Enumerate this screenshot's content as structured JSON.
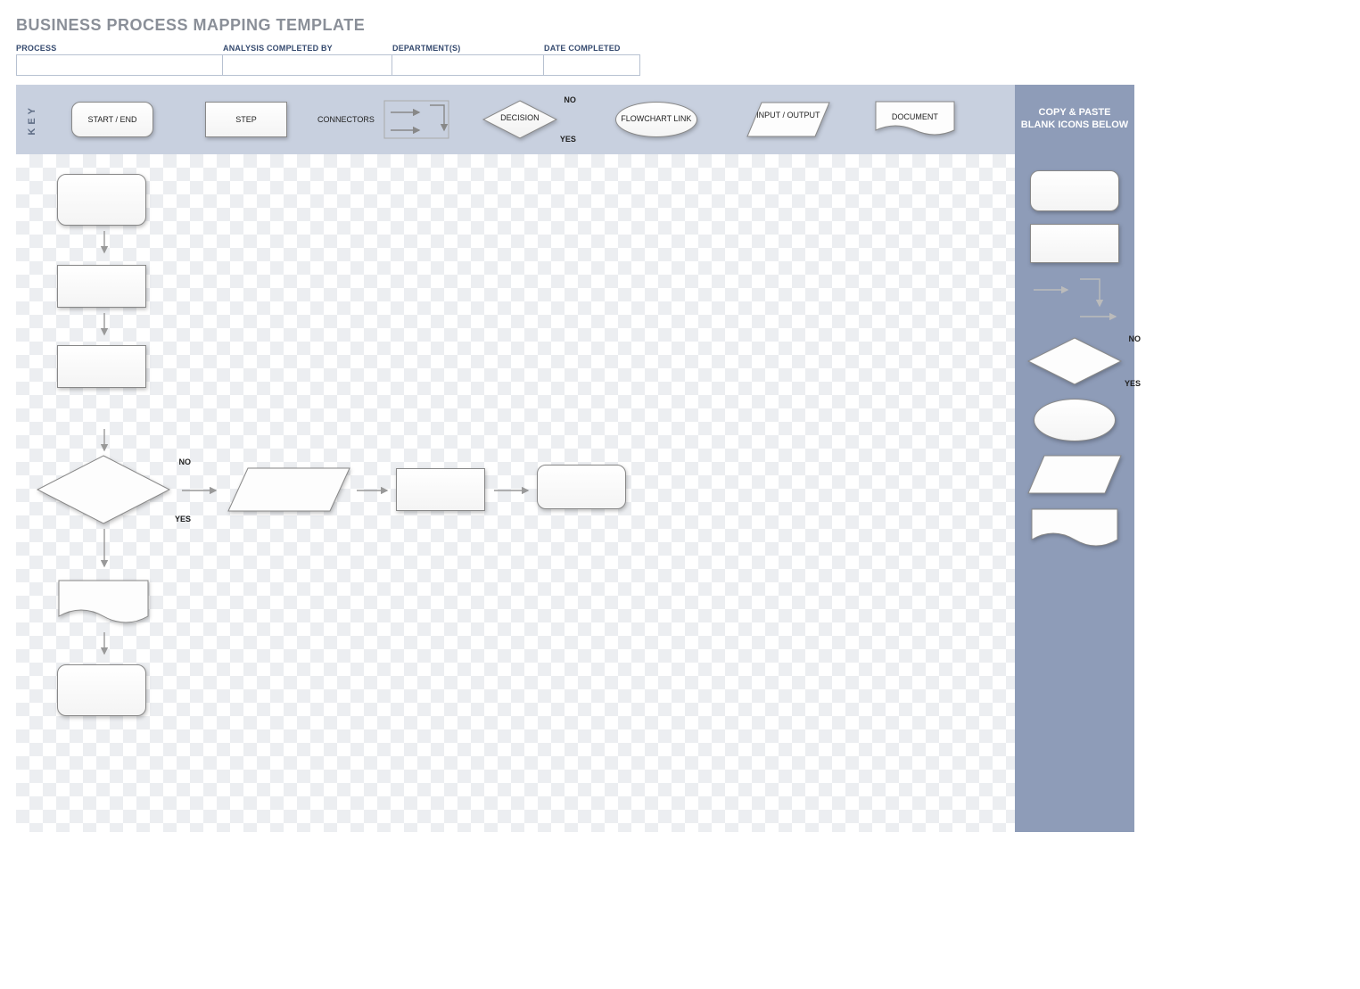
{
  "title": "BUSINESS PROCESS MAPPING TEMPLATE",
  "header": {
    "process": "PROCESS",
    "analyst": "ANALYSIS COMPLETED BY",
    "dept": "DEPARTMENT(S)",
    "date": "DATE COMPLETED"
  },
  "key": {
    "label": "KEY",
    "start_end": "START / END",
    "step": "STEP",
    "connectors": "CONNECTORS",
    "decision": "DECISION",
    "flowchart_link": "FLOWCHART LINK",
    "io": "INPUT / OUTPUT",
    "document": "DOCUMENT",
    "no": "NO",
    "yes": "YES"
  },
  "palette_title": "COPY & PASTE BLANK ICONS BELOW",
  "canvas": {
    "no": "NO",
    "yes": "YES"
  },
  "palette": {
    "no": "NO",
    "yes": "YES"
  }
}
